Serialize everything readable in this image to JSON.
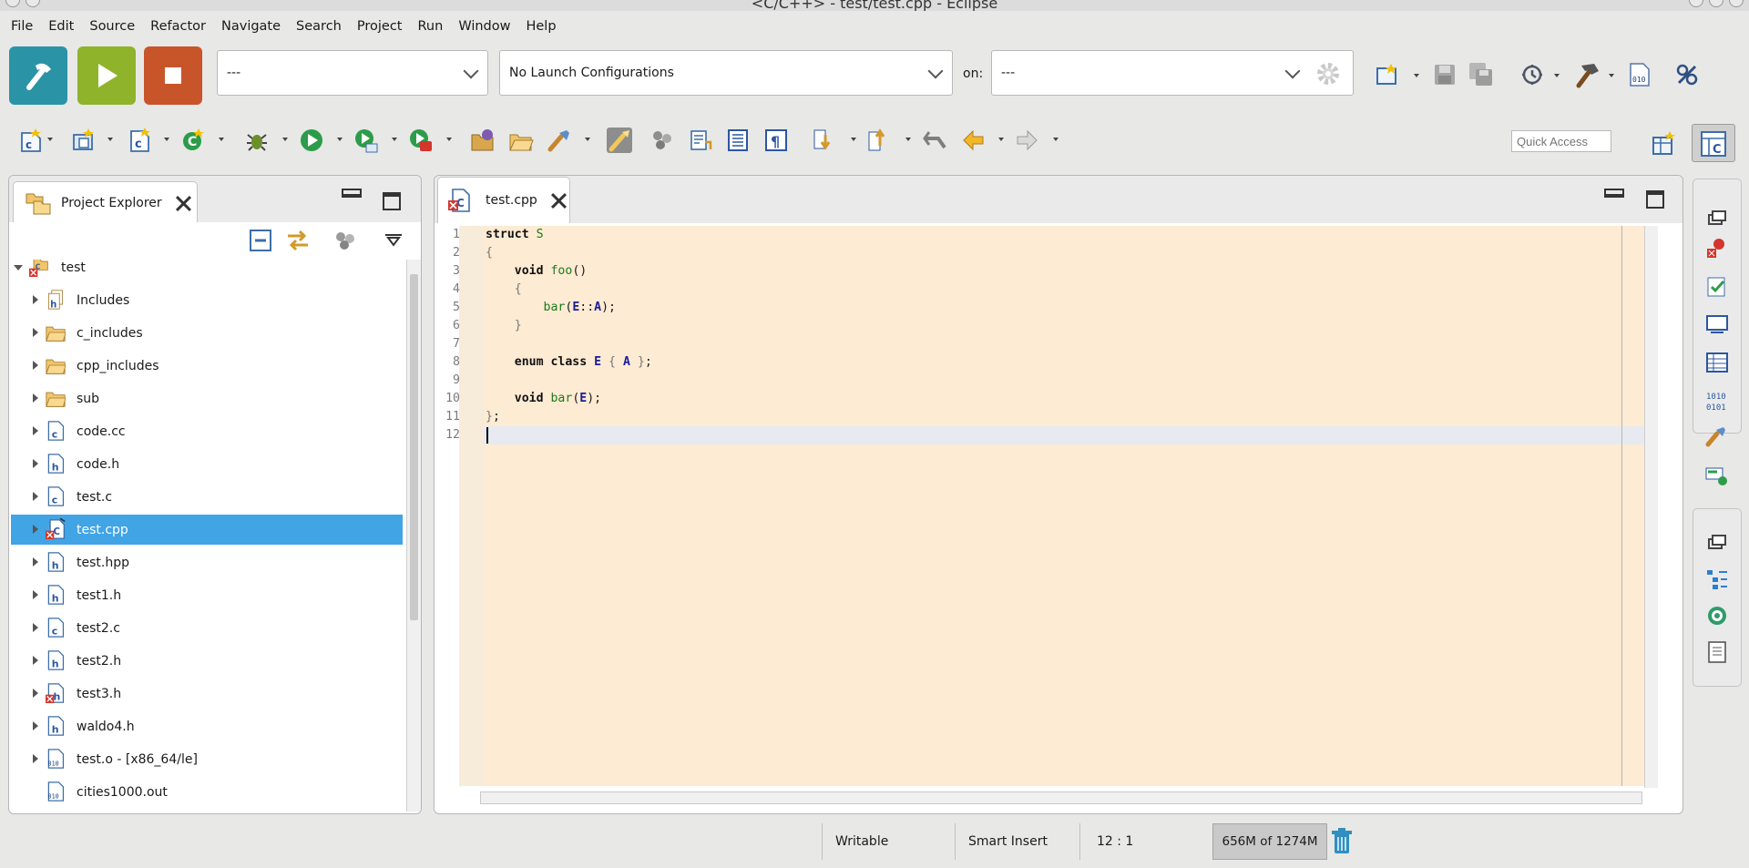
{
  "window": {
    "title": "<C/C++> - test/test.cpp - Eclipse"
  },
  "menu": [
    "File",
    "Edit",
    "Source",
    "Refactor",
    "Navigate",
    "Search",
    "Project",
    "Run",
    "Window",
    "Help"
  ],
  "launch": {
    "mode_value": "---",
    "config_value": "No Launch Configurations",
    "on_label": "on:",
    "target_value": "---"
  },
  "quick_access": {
    "placeholder": "Quick Access"
  },
  "explorer": {
    "title": "Project Explorer",
    "items": [
      {
        "label": "test",
        "icon": "project-icon",
        "expanded": true
      },
      {
        "label": "Includes",
        "icon": "includes-icon"
      },
      {
        "label": "c_includes",
        "icon": "folder-icon"
      },
      {
        "label": "cpp_includes",
        "icon": "folder-icon"
      },
      {
        "label": "sub",
        "icon": "folder-icon"
      },
      {
        "label": "code.cc",
        "icon": "c-source-icon"
      },
      {
        "label": "code.h",
        "icon": "header-icon"
      },
      {
        "label": "test.c",
        "icon": "c-source-icon"
      },
      {
        "label": "test.cpp",
        "icon": "cpp-source-error-icon",
        "selected": true
      },
      {
        "label": "test.hpp",
        "icon": "header-icon"
      },
      {
        "label": "test1.h",
        "icon": "header-icon"
      },
      {
        "label": "test2.c",
        "icon": "c-source-icon"
      },
      {
        "label": "test2.h",
        "icon": "header-icon"
      },
      {
        "label": "test3.h",
        "icon": "header-error-icon"
      },
      {
        "label": "waldo4.h",
        "icon": "header-icon"
      },
      {
        "label": "test.o - [x86_64/le]",
        "icon": "binary-icon"
      },
      {
        "label": "cities1000.out",
        "icon": "binary-icon"
      }
    ]
  },
  "editor": {
    "tab_label": "test.cpp",
    "line_numbers": [
      "1",
      "2",
      "3",
      "4",
      "5",
      "6",
      "7",
      "8",
      "9",
      "10",
      "11",
      "12"
    ],
    "lines": [
      "struct S",
      "{",
      "    void foo()",
      "    {",
      "        bar(E::A);",
      "    }",
      "",
      "    enum class E { A };",
      "",
      "    void bar(E);",
      "};",
      ""
    ]
  },
  "status": {
    "mode": "Writable",
    "insert": "Smart Insert",
    "position": "12 : 1",
    "heap": "656M of 1274M"
  },
  "colors": {
    "build_button": "#2a94a6",
    "run_button": "#8fb32b",
    "stop_button": "#c8542a",
    "selection": "#41a4e5",
    "editor_bg": "#fdebd3"
  }
}
